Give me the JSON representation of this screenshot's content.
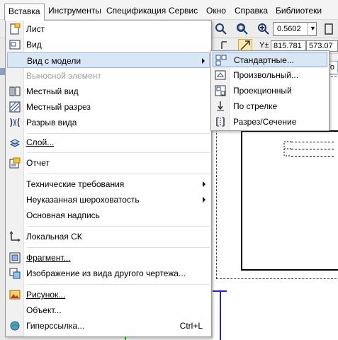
{
  "menubar": {
    "items": [
      "Вставка",
      "Инструменты",
      "Спецификация",
      "Сервис",
      "Окно",
      "Справка",
      "Библиотеки"
    ]
  },
  "toolbar": {
    "zoom_value": "0.5602",
    "coord_y_label": "Y±",
    "coord_x_value": "815.781",
    "coord_y_value": "573.07",
    "tab_label": "Го"
  },
  "menu": {
    "items": [
      {
        "label": "Лист",
        "icon": "sheet-icon"
      },
      {
        "label": "Вид",
        "icon": "view-icon"
      },
      {
        "label": "Вид с модели",
        "icon": "",
        "submenu": true
      },
      {
        "label": "Выносной элемент",
        "icon": "",
        "disabled": true
      },
      {
        "label": "Местный вид",
        "icon": "local-view-icon"
      },
      {
        "label": "Местный разрез",
        "icon": "local-section-icon"
      },
      {
        "label": "Разрыв вида",
        "icon": "view-break-icon"
      },
      {
        "label": "Слой...",
        "icon": "layer-icon"
      },
      {
        "label": "Отчет",
        "icon": "report-icon"
      },
      {
        "label": "Технические требования",
        "icon": "",
        "submenu": true
      },
      {
        "label": "Неуказанная шероховатость",
        "icon": "",
        "submenu": true
      },
      {
        "label": "Основная надпись",
        "icon": ""
      },
      {
        "label": "Локальная СК",
        "icon": "local-cs-icon"
      },
      {
        "label": "Фрагмент...",
        "icon": "fragment-icon"
      },
      {
        "label": "Изображение из вида другого чертежа...",
        "icon": "image-from-view-icon"
      },
      {
        "label": "Рисунок...",
        "icon": "picture-icon"
      },
      {
        "label": "Объект...",
        "icon": ""
      },
      {
        "label": "Гиперссылка...",
        "icon": "hyperlink-icon",
        "shortcut": "Ctrl+L"
      }
    ]
  },
  "submenu": {
    "items": [
      {
        "label": "Стандартные...",
        "icon": "standard-views-icon"
      },
      {
        "label": "Произвольный...",
        "icon": "arbitrary-view-icon"
      },
      {
        "label": "Проекционный",
        "icon": "projection-view-icon"
      },
      {
        "label": "По стрелке",
        "icon": "arrow-view-icon"
      },
      {
        "label": "Разрез/Сечение",
        "icon": "section-view-icon"
      }
    ]
  },
  "colors": {
    "highlight": "#d9e6f5",
    "highlight_border": "#9cb9dd",
    "disabled_text": "#9c9c9c",
    "drawing_blue": "#2424c8",
    "drawing_green": "#19b319"
  }
}
